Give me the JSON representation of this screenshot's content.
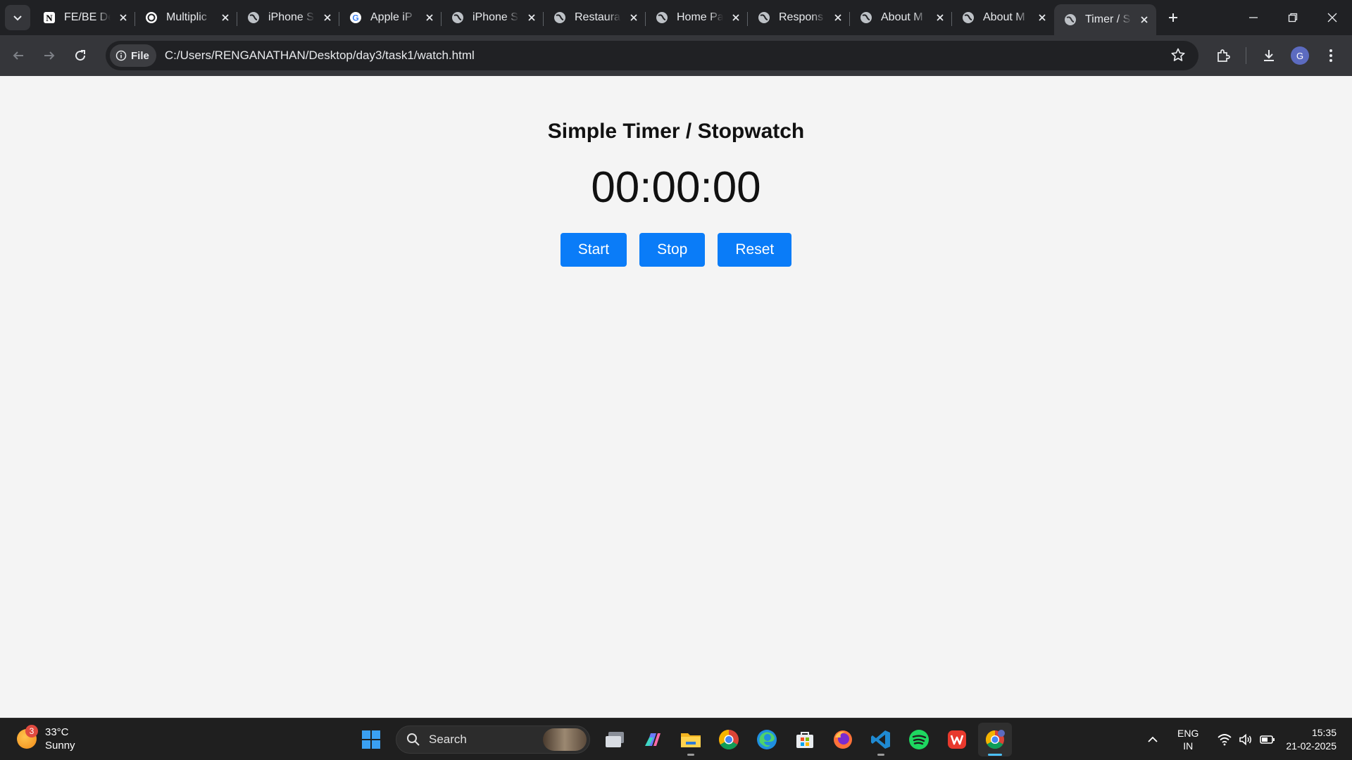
{
  "browser": {
    "tabs": [
      {
        "title": "FE/BE De",
        "icon": "notion-icon"
      },
      {
        "title": "Multiplic",
        "icon": "chatgpt-icon"
      },
      {
        "title": "iPhone S",
        "icon": "globe-icon"
      },
      {
        "title": "Apple iP",
        "icon": "google-icon"
      },
      {
        "title": "iPhone S",
        "icon": "globe-icon"
      },
      {
        "title": "Restaura",
        "icon": "globe-icon"
      },
      {
        "title": "Home Pa",
        "icon": "globe-icon"
      },
      {
        "title": "Respons",
        "icon": "globe-icon"
      },
      {
        "title": "About M",
        "icon": "globe-icon"
      },
      {
        "title": "About M",
        "icon": "globe-icon"
      },
      {
        "title": "Timer / S",
        "icon": "globe-icon",
        "active": true
      }
    ],
    "chip_label": "File",
    "url": "C:/Users/RENGANATHAN/Desktop/day3/task1/watch.html",
    "profile_initial": "G"
  },
  "page": {
    "heading": "Simple Timer / Stopwatch",
    "time": "00:00:00",
    "buttons": {
      "start": "Start",
      "stop": "Stop",
      "reset": "Reset"
    },
    "accent": "#0a7cf8"
  },
  "taskbar": {
    "weather": {
      "badge": "3",
      "temp": "33°C",
      "condition": "Sunny"
    },
    "search_label": "Search",
    "lang": {
      "line1": "ENG",
      "line2": "IN"
    },
    "clock": {
      "time": "15:35",
      "date": "21-02-2025"
    }
  }
}
